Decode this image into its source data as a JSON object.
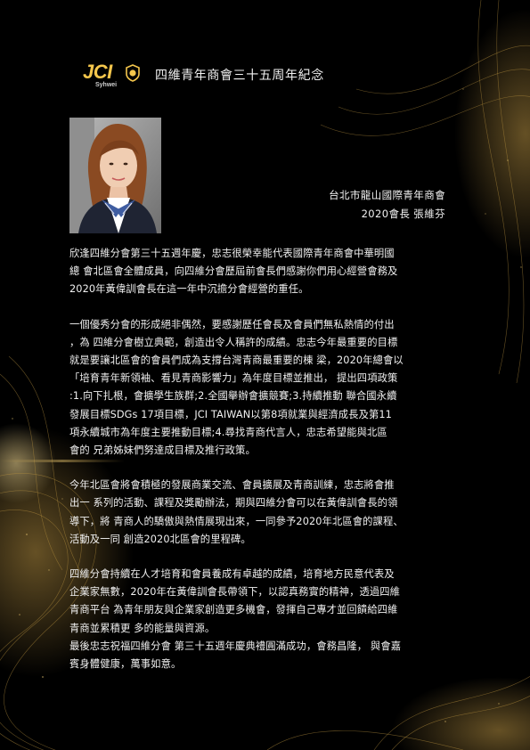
{
  "header": {
    "logo_text": "JCI",
    "logo_sub": "Syhwei",
    "title": "四維青年商會三十五周年紀念"
  },
  "signature": {
    "org": "台北市龍山國際青年商會",
    "role": "2020會長 張維芬"
  },
  "paragraphs": [
    {
      "lines": [
        "欣逢四維分會第三十五週年慶，忠志很榮幸能代表國際青年商會中華明國",
        "總 會北區會全體成員，向四維分會歷屆前會長們感謝你們用心經營會務及",
        "2020年黃偉訓會長在這一年中沉擔分會經營的重任。"
      ]
    },
    {
      "lines": [
        "一個優秀分會的形成絕非偶然，要感謝歷任會長及會員們無私熱情的付出",
        "，為 四維分會樹立典範，創造出令人稱許的成績。忠志今年最重要的目標",
        "就是要讓北區會的會員們成為支撐台灣青商最重要的棟 梁，2020年總會以",
        "「培育青年新領袖、看見青商影響力」為年度目標並推出， 提出四項政策",
        ":1.向下扎根，會擴學生族群;2.全國舉辦會擴競賽;3.持續推動 聯合國永續",
        "發展目標SDGs 17項目標，JCI TAIWAN以第8項就業與經濟成長及第11",
        " 項永續城市為年度主要推動目標;4.尋找青商代言人，忠志希望能與北區",
        "會的 兄弟姊妹們努達成目標及推行政策。"
      ]
    },
    {
      "lines": [
        "今年北區會將會積極的發展商業交流、會員擴展及青商訓練，忠志將會推",
        "出一 系列的活動、課程及獎勵辦法，期與四維分會可以在黃偉訓會長的領",
        "導下，將 青商人的驕傲與熱情展現出來，一同參予2020年北區會的課程、",
        "活動及一同 創造2020北區會的里程碑。"
      ]
    },
    {
      "lines": [
        "四維分會持續在人才培育和會員養成有卓越的成績，培育地方民意代表及",
        "企業家無數，2020年在黃偉訓會長帶領下，以認真務實的精神，透過四維",
        "青商平台 為青年朋友與企業家創造更多機會，發揮自己專才並回饋給四維",
        "青商並累積更 多的能量與資源。",
        "最後忠志祝福四維分會 第三十五週年慶典禮圓滿成功，會務昌隆， 與會嘉",
        "賓身體健康，萬事如意。"
      ]
    }
  ],
  "colors": {
    "background": "#000000",
    "gold": "#c9a24a",
    "logo_gold": "#f4c64c",
    "text": "#f0f0f0"
  }
}
